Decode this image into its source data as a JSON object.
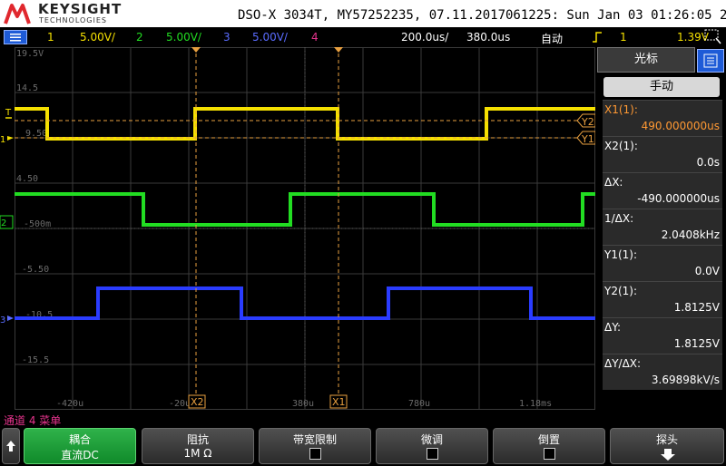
{
  "header": {
    "brand": "KEYSIGHT",
    "brand_sub": "TECHNOLOGIES",
    "model_info": "DSO-X 3034T, MY57252235, 07.11.2017061225: Sun Jan 03 01:26:05 2021"
  },
  "statusbar": {
    "ch1_num": "1",
    "ch1_scale": "5.00V/",
    "ch2_num": "2",
    "ch2_scale": "5.00V/",
    "ch3_num": "3",
    "ch3_scale": "5.00V/",
    "ch4_num": "4",
    "timebase": "200.0us/",
    "delay": "380.0us",
    "trigger_mode": "自动",
    "trigger_source": "1",
    "trigger_level": "1.39V"
  },
  "colors": {
    "ch1": "#f5e000",
    "ch2": "#22dd22",
    "ch3": "#2a3cff",
    "ch4": "#e5338c",
    "cursor": "#e8a040",
    "grid": "#3a3a3a",
    "panel_value_orange": "#ff9933"
  },
  "grid": {
    "y_labels": [
      "19.5V",
      "14.5",
      "9.50",
      "4.50",
      "-500m",
      "-5.50",
      "-10.5",
      "-15.5"
    ],
    "x_labels": [
      "-420u",
      "-20u",
      "380u",
      "780u",
      "1.18ms"
    ],
    "markers": {
      "trig": "T",
      "ch1": "1",
      "ch2": "2",
      "ch3": "3",
      "x1": "X1",
      "x2": "X2",
      "y1": "Y1",
      "y2": "Y2"
    }
  },
  "panel": {
    "tab_label": "光标",
    "mode_button": "手动",
    "readouts": [
      {
        "label": "X1(1):",
        "value": "490.000000us"
      },
      {
        "label": "X2(1):",
        "value": "0.0s"
      },
      {
        "label": "ΔX:",
        "value": "-490.000000us"
      },
      {
        "label": "1/ΔX:",
        "value": "2.0408kHz"
      },
      {
        "label": "Y1(1):",
        "value": "0.0V"
      },
      {
        "label": "Y2(1):",
        "value": "1.8125V"
      },
      {
        "label": "ΔY:",
        "value": "1.8125V"
      },
      {
        "label": "ΔY/ΔX:",
        "value": "3.69898kV/s"
      }
    ]
  },
  "menu": {
    "title": "通道 4 菜单",
    "coupling_label": "耦合",
    "coupling_value": "直流DC",
    "impedance_label": "阻抗",
    "impedance_value": "1M Ω",
    "bw_limit_label": "带宽限制",
    "fine_label": "微调",
    "invert_label": "倒置",
    "probe_label": "探头"
  }
}
